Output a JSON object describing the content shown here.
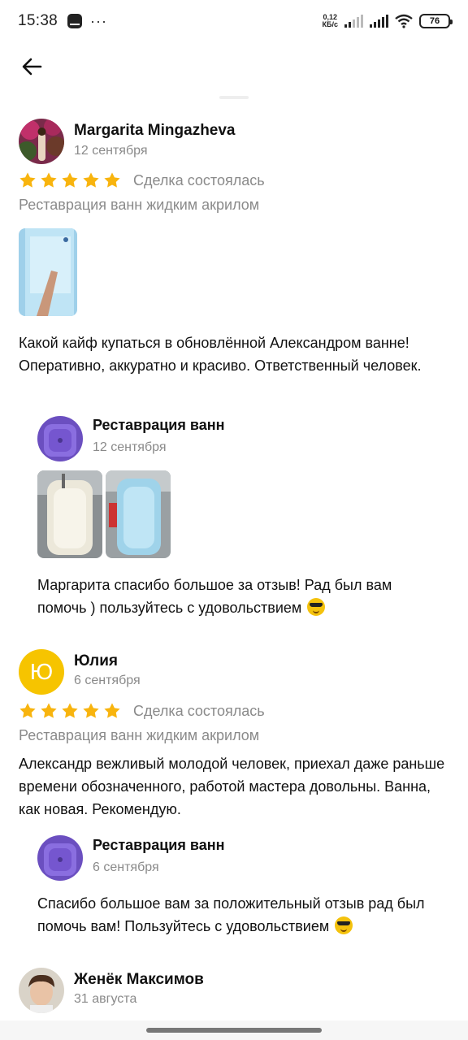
{
  "status_bar": {
    "time": "15:38",
    "dots": "···",
    "speed_value": "0,12",
    "speed_unit": "КБ/с",
    "battery": "76"
  },
  "reviews": [
    {
      "author": "Margarita Mingazheva",
      "date": "12 сентября",
      "rating": 5,
      "deal_status": "Сделка состоялась",
      "service": "Реставрация ванн жидким акрилом",
      "text": "Какой кайф купаться в обновлённой Александром ванне! Оперативно, аккуратно и красиво. Ответственный человек.",
      "reply": {
        "author": "Реставрация ванн",
        "date": "12 сентября",
        "text": "Маргарита спасибо большое за отзыв! Рад был вам помочь ) пользуйтесь с удовольствием"
      }
    },
    {
      "author": "Юлия",
      "avatar_letter": "Ю",
      "date": "6 сентября",
      "rating": 5,
      "deal_status": "Сделка состоялась",
      "service": "Реставрация ванн жидким акрилом",
      "text": "Александр вежливый молодой человек, приехал даже раньше  времени обозначенного, работой мастера довольны. Ванна, как новая. Рекомендую.",
      "reply": {
        "author": "Реставрация ванн",
        "date": "6 сентября",
        "text": "Спасибо большое вам за положительный отзыв рад был помочь вам! Пользуйтесь с удовольствием"
      }
    },
    {
      "author": "Женёк Максимов",
      "date": "31 августа"
    }
  ],
  "colors": {
    "star": "#f8b40e",
    "muted_text": "#8a8a8a",
    "letter_avatar": "#f6c400"
  }
}
